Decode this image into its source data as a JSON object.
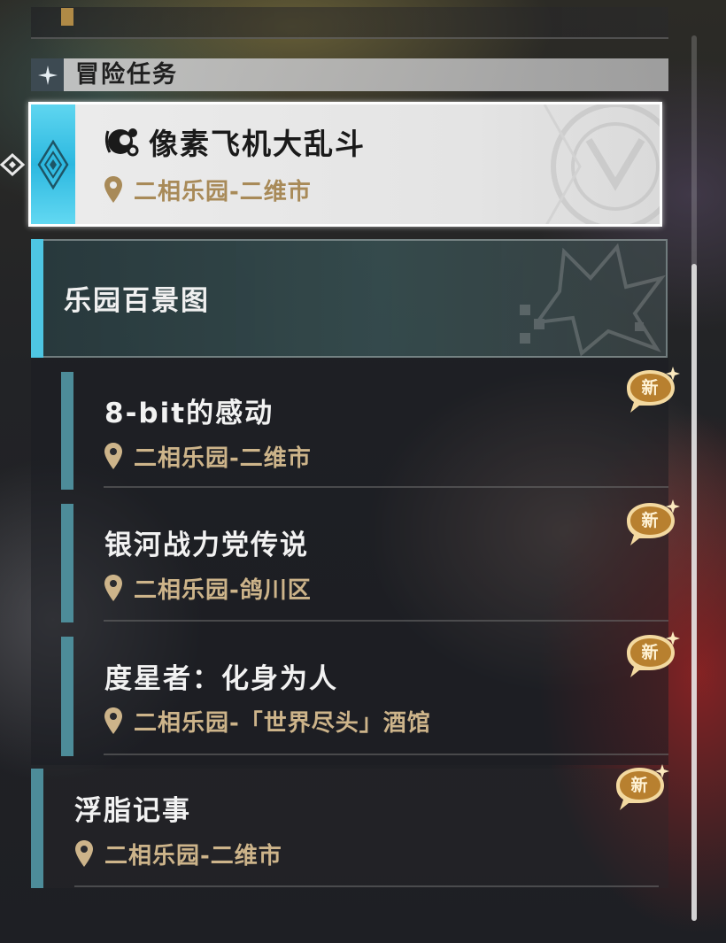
{
  "section": {
    "title": "冒险任务",
    "icon": "sparkle-icon"
  },
  "selected_quest": {
    "title": "像素飞机大乱斗",
    "location": "二相乐园-二维市",
    "icon": "quest-type-icon"
  },
  "category": {
    "title": "乐园百景图"
  },
  "quests": [
    {
      "title": "8-bit的感动",
      "location": "二相乐园-二维市",
      "badge": "新"
    },
    {
      "title": "银河战力党传说",
      "location": "二相乐园-鸽川区",
      "badge": "新"
    },
    {
      "title": "度星者：化身为人",
      "location": "二相乐园-「世界尽头」酒馆",
      "badge": "新"
    },
    {
      "title": "浮脂记事",
      "location": "二相乐园-二维市",
      "badge": "新"
    }
  ],
  "colors": {
    "accent_cyan": "#4ec6e3",
    "location_gold": "#cdb48a",
    "badge_gold": "#c8903a"
  }
}
